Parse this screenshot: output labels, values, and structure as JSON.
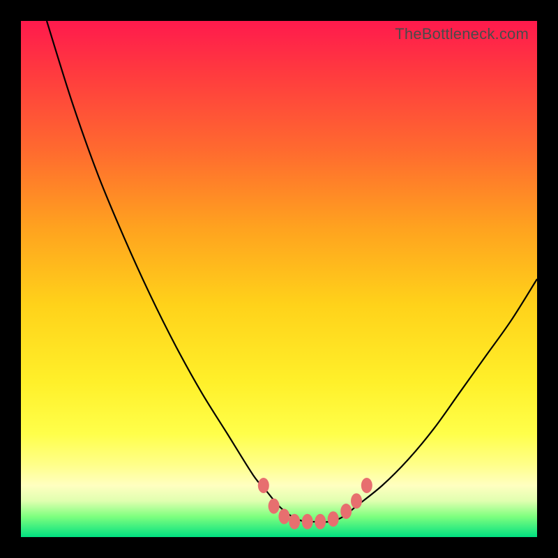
{
  "watermark": "TheBottleneck.com",
  "chart_data": {
    "type": "line",
    "title": "",
    "xlabel": "",
    "ylabel": "",
    "xlim": [
      0,
      100
    ],
    "ylim": [
      0,
      100
    ],
    "series": [
      {
        "name": "curve",
        "x": [
          5,
          10,
          15,
          20,
          25,
          30,
          35,
          40,
          45,
          47.5,
          50,
          52.5,
          55,
          57.5,
          60,
          62.5,
          65,
          70,
          75,
          80,
          85,
          90,
          95,
          100
        ],
        "y": [
          100,
          84,
          70,
          58,
          47,
          37,
          28,
          20,
          12,
          9,
          6,
          4,
          3,
          3,
          3,
          4,
          6,
          10,
          15,
          21,
          28,
          35,
          42,
          50
        ]
      }
    ],
    "markers": {
      "name": "base-dots",
      "color": "#e76f6f",
      "points": [
        {
          "x": 47,
          "y": 10
        },
        {
          "x": 49,
          "y": 6
        },
        {
          "x": 51,
          "y": 4
        },
        {
          "x": 53,
          "y": 3
        },
        {
          "x": 55.5,
          "y": 3
        },
        {
          "x": 58,
          "y": 3
        },
        {
          "x": 60.5,
          "y": 3.5
        },
        {
          "x": 63,
          "y": 5
        },
        {
          "x": 65,
          "y": 7
        },
        {
          "x": 67,
          "y": 10
        }
      ]
    }
  }
}
